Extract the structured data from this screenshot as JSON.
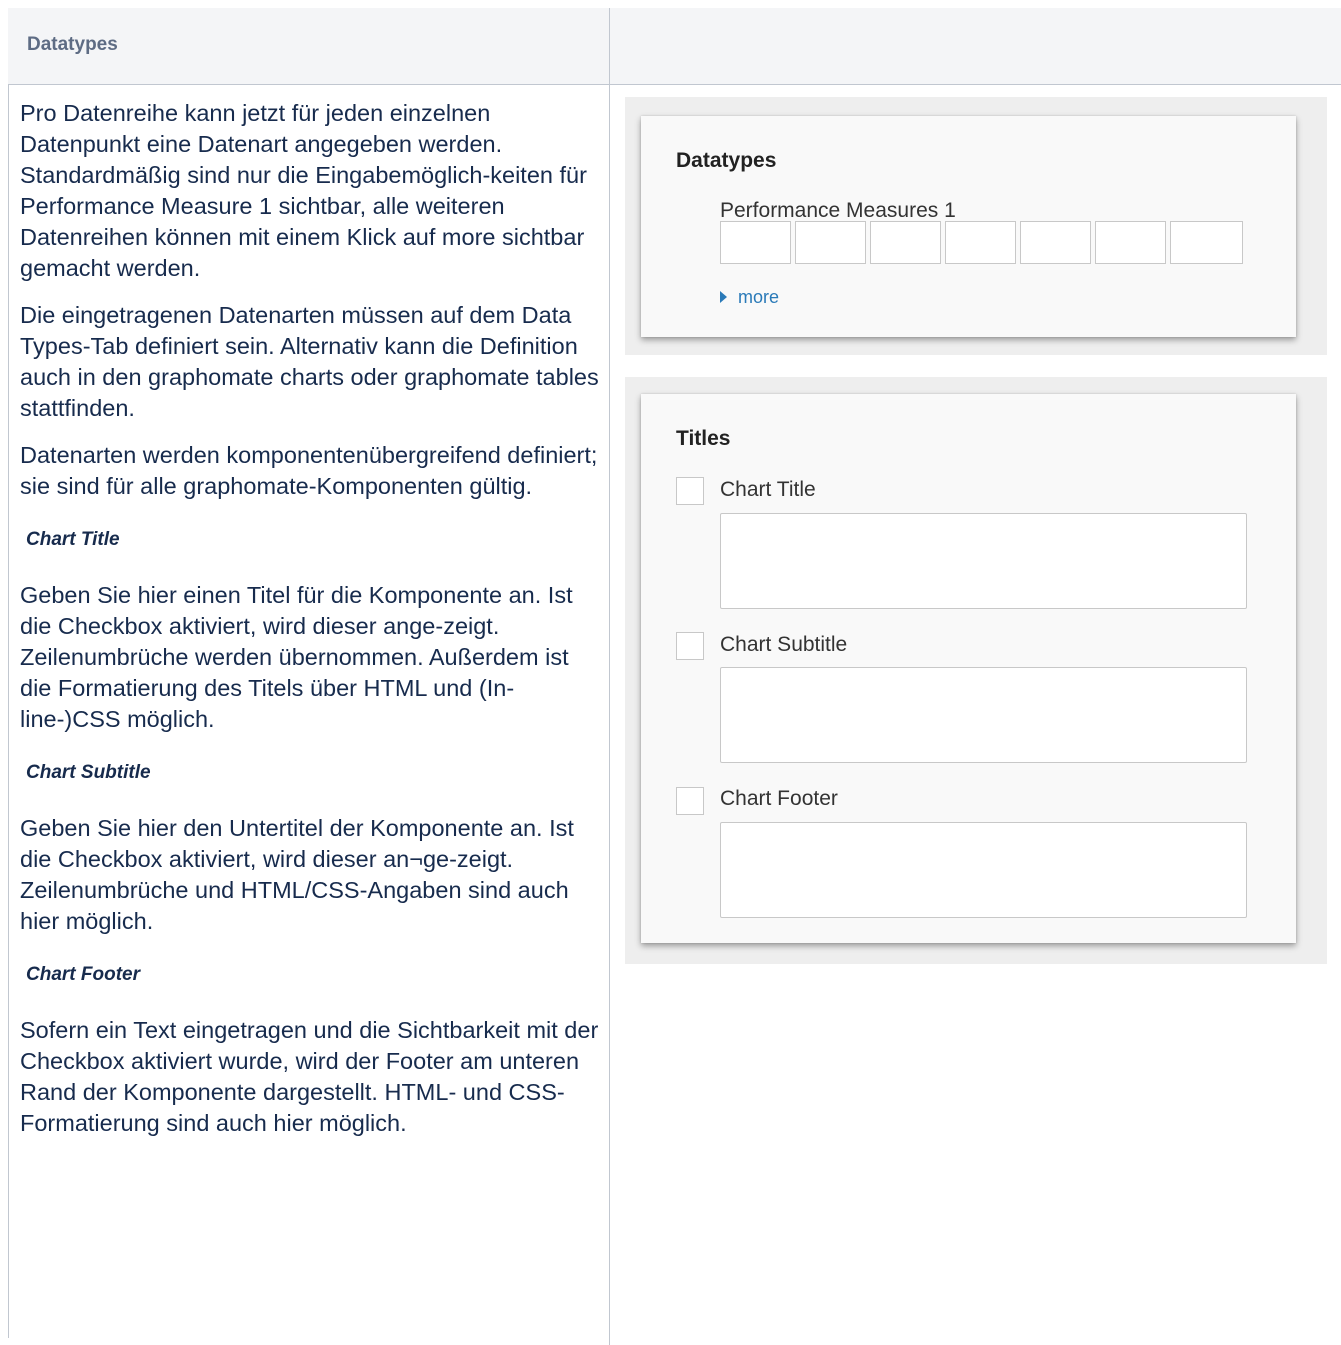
{
  "header": {
    "left": "Datatypes",
    "right": ""
  },
  "description": {
    "p1": "Pro Datenreihe kann jetzt für jeden einzelnen Datenpunkt eine Datenart angegeben werden. Standardmäßig sind nur die Eingabemöglich-keiten für Performance Measure 1 sichtbar, alle weiteren Datenreihen können mit einem Klick auf more sichtbar gemacht werden.",
    "p2": "Die eingetragenen Datenarten müssen auf dem Data Types-Tab definiert sein. Alternativ kann die Definition auch in den graphomate charts oder graphomate tables stattfinden.",
    "p3": "Datenarten werden komponentenübergreifend definiert; sie sind für alle graphomate-Komponenten gültig.",
    "chart_title_heading": "Chart Title",
    "chart_title_text": "Geben Sie hier einen Titel für die Komponente an. Ist die Checkbox aktiviert, wird dieser ange-zeigt. Zeilenumbrüche werden übernommen. Außerdem ist die Formatierung des Titels über HTML und (In-line-)CSS möglich.",
    "chart_subtitle_heading": "Chart Subtitle",
    "chart_subtitle_text": "Geben Sie hier den Untertitel der Komponente an. Ist die Checkbox aktiviert, wird dieser an¬ge-zeigt. Zeilenumbrüche und HTML/CSS-Angaben sind auch hier möglich.",
    "chart_footer_heading": "Chart Footer",
    "chart_footer_text": "Sofern ein Text eingetragen und die Sichtbarkeit mit der Checkbox aktiviert wurde, wird der Footer am unteren Rand der Komponente dargestellt. HTML- und CSS-Formatierung sind auch hier möglich."
  },
  "datatypes_panel": {
    "title": "Datatypes",
    "measure_label": "Performance Measures 1",
    "cells": [
      "",
      "",
      "",
      "",
      "",
      "",
      ""
    ],
    "more_label": "more"
  },
  "titles_panel": {
    "title": "Titles",
    "fields": [
      {
        "label": "Chart Title",
        "checked": false,
        "value": ""
      },
      {
        "label": "Chart Subtitle",
        "checked": false,
        "value": ""
      },
      {
        "label": "Chart Footer",
        "checked": false,
        "value": ""
      }
    ]
  }
}
